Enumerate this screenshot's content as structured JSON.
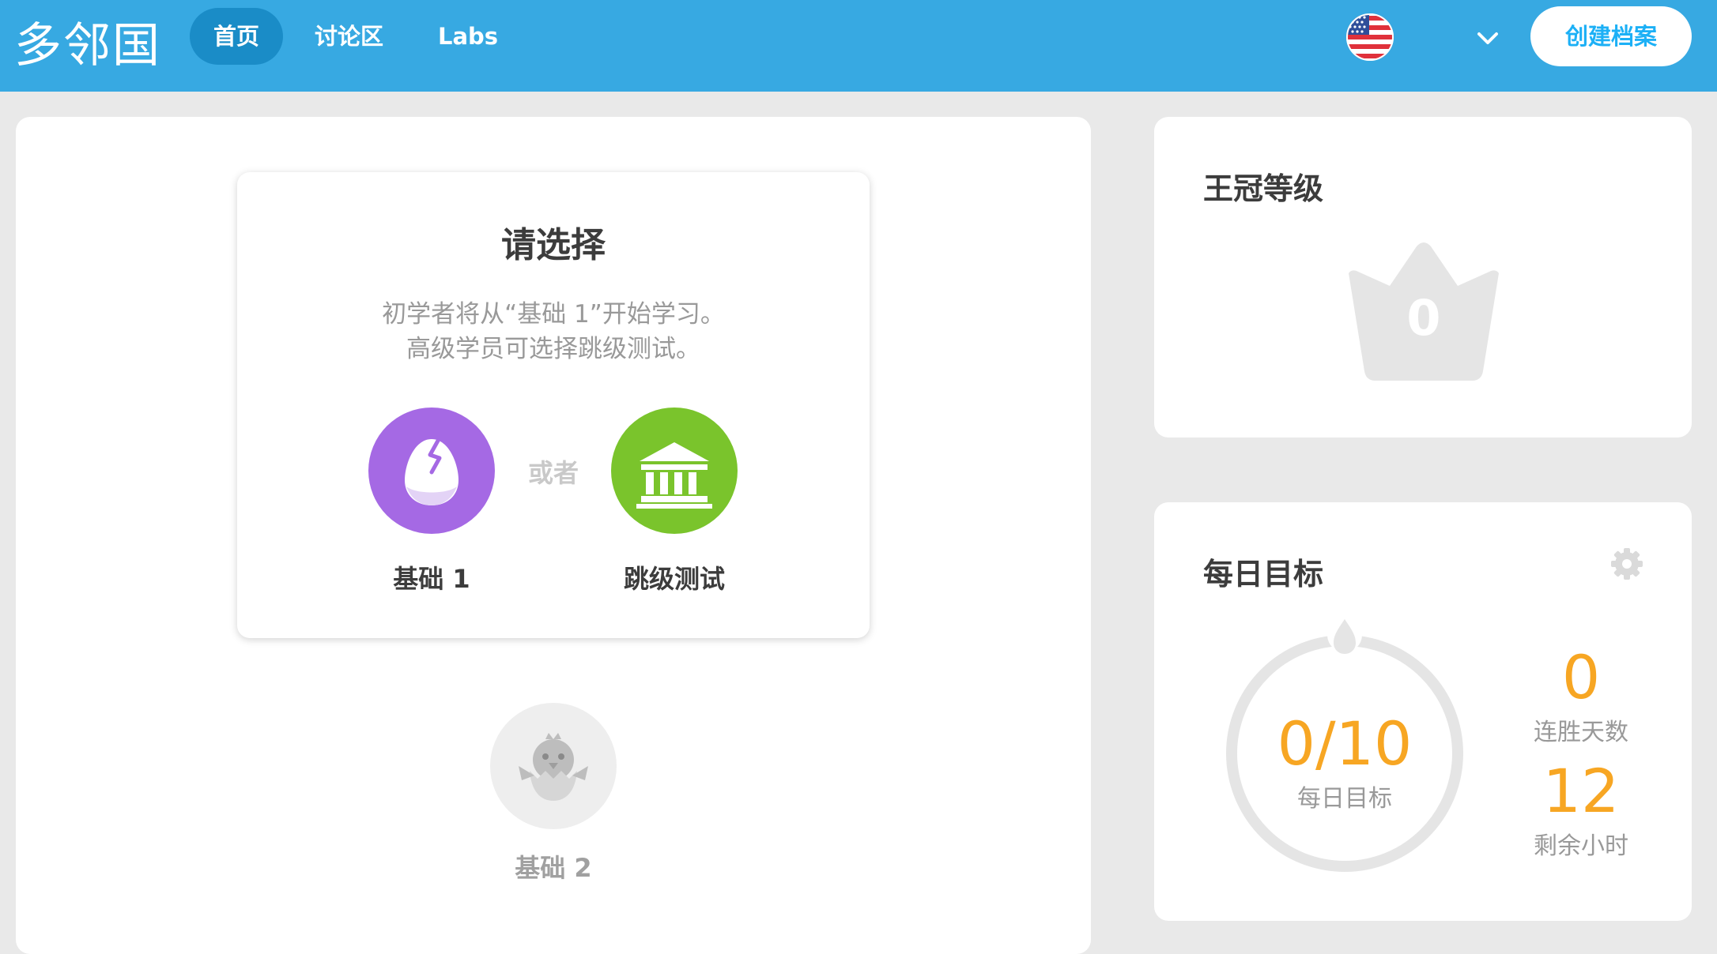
{
  "header": {
    "logo": "多邻国",
    "tabs": [
      {
        "label": "首页",
        "active": true
      },
      {
        "label": "讨论区",
        "active": false
      },
      {
        "label": "Labs",
        "active": false
      }
    ],
    "language_icon": "us-flag-icon",
    "create_profile_label": "创建档案"
  },
  "choose_card": {
    "title": "请选择",
    "desc_line1": "初学者将从“基础 1”开始学习。",
    "desc_line2": "高级学员可选择跳级测试。",
    "option_basic": "基础 1",
    "or_text": "或者",
    "option_test": "跳级测试"
  },
  "skill_tree": {
    "next_skill_label": "基础 2"
  },
  "crown_level": {
    "title": "王冠等级",
    "crowns": "0"
  },
  "daily_goal": {
    "title": "每日目标",
    "progress": "0/10",
    "progress_label": "每日目标",
    "streak_value": "0",
    "streak_label": "连胜天数",
    "hours_value": "12",
    "hours_label": "剩余小时"
  },
  "colors": {
    "header_bg": "#37a9e2",
    "active_tab": "#1a8cc7",
    "basic_purple": "#a569e4",
    "test_green": "#7ac42c",
    "goal_orange": "#f7a623"
  }
}
